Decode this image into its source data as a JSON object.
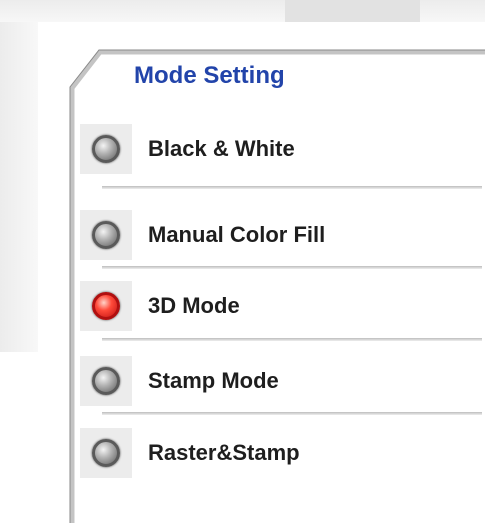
{
  "panel": {
    "title": "Mode Setting",
    "options": [
      {
        "label": "Black & White",
        "state": "off"
      },
      {
        "label": "Manual Color Fill",
        "state": "off"
      },
      {
        "label": "3D Mode",
        "state": "on"
      },
      {
        "label": "Stamp Mode",
        "state": "off"
      },
      {
        "label": "Raster&Stamp",
        "state": "off"
      }
    ],
    "selected": "3D Mode"
  },
  "colors": {
    "title": "#2244aa",
    "lamp_on": "#ff3a2a",
    "lamp_off": "#8a8a8a",
    "label": "#1e1e1e"
  },
  "icons": {
    "indicator_on": "red-radio-lamp-icon",
    "indicator_off": "gray-radio-lamp-icon"
  }
}
